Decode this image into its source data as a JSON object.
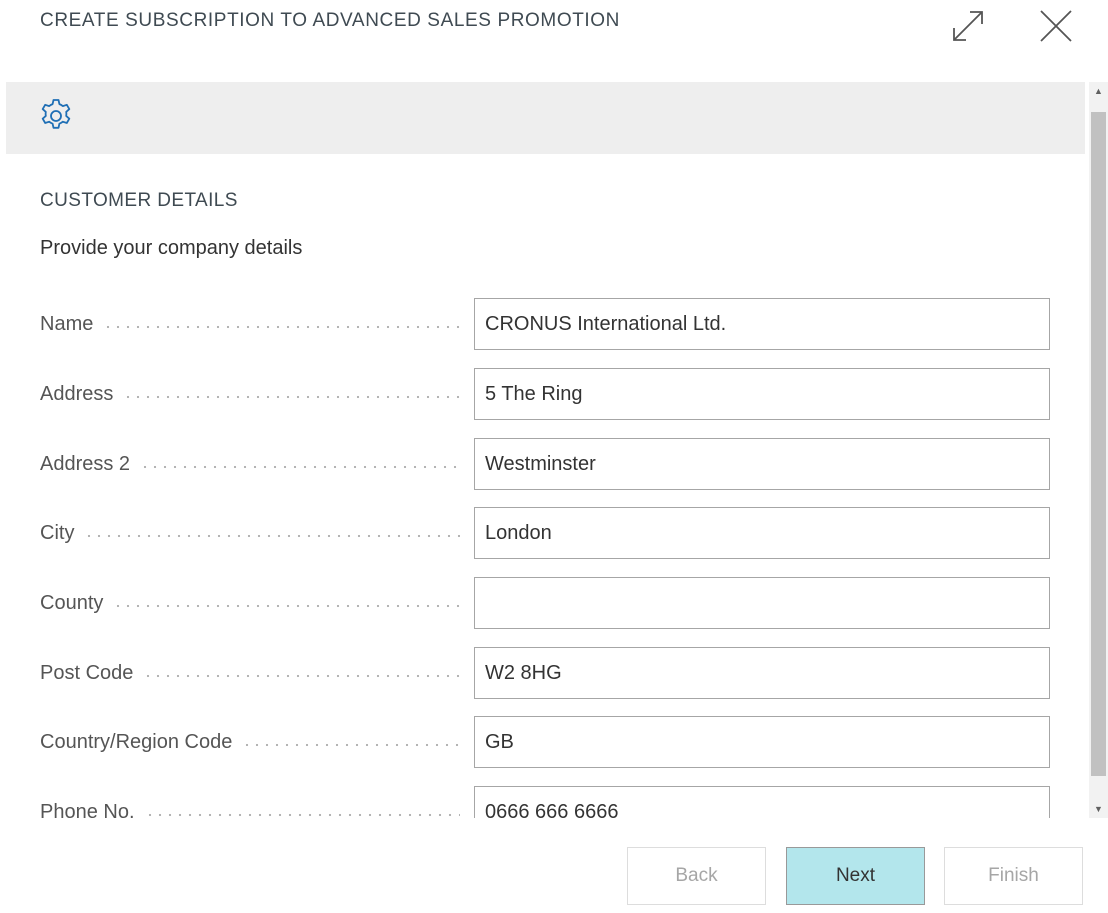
{
  "dialog": {
    "title": "CREATE SUBSCRIPTION TO ADVANCED SALES PROMOTION",
    "expand_icon": "expand-arrows-icon",
    "close_icon": "close-x-icon"
  },
  "toolbar": {
    "settings_icon": "gear-icon"
  },
  "section": {
    "title": "CUSTOMER DETAILS",
    "description": "Provide your company details"
  },
  "fields": [
    {
      "label": "Name",
      "value": "CRONUS International Ltd."
    },
    {
      "label": "Address",
      "value": "5 The Ring"
    },
    {
      "label": "Address 2",
      "value": "Westminster"
    },
    {
      "label": "City",
      "value": "London"
    },
    {
      "label": "County",
      "value": ""
    },
    {
      "label": "Post Code",
      "value": "W2 8HG"
    },
    {
      "label": "Country/Region Code",
      "value": "GB"
    },
    {
      "label": "Phone No.",
      "value": "0666 666 6666"
    }
  ],
  "buttons": {
    "back": "Back",
    "next": "Next",
    "finish": "Finish"
  },
  "colors": {
    "next_button_bg": "#b3e6ec",
    "toolbar_bg": "#eeeeee",
    "title_text": "#3f4a52"
  }
}
